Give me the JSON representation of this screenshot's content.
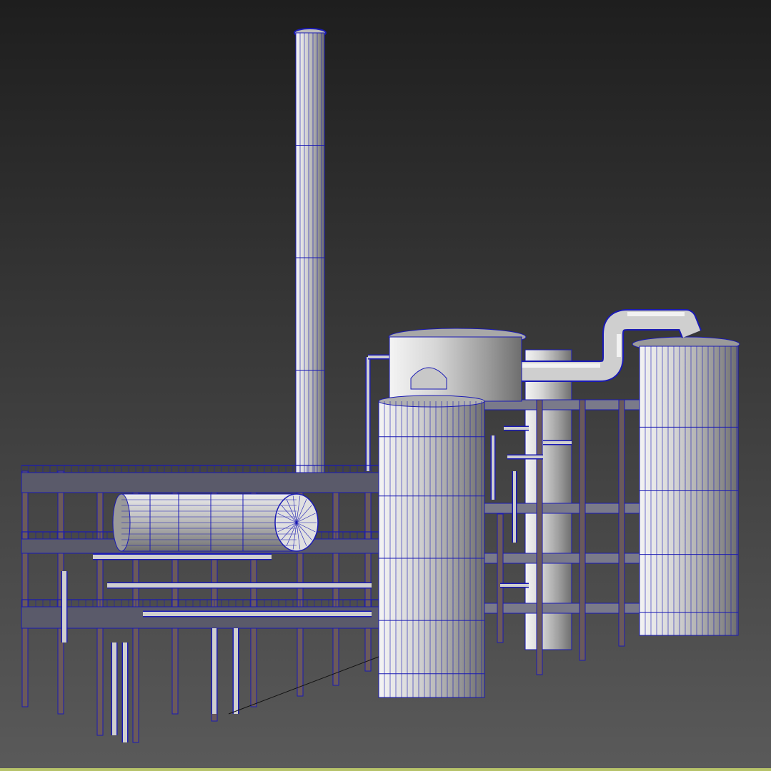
{
  "viewport": {
    "render_mode": "wireframe-on-shaded",
    "background_top": "#1e1e1e",
    "background_bottom": "#5a5a5a",
    "wire_color": "#1a1ab4",
    "surface_light": "#d8d8d8",
    "surface_dark": "#7a7a7a",
    "support_color": "#6b5a5a",
    "accent_strip": "#b7c36a"
  },
  "scene": {
    "subject": "refinery-unit",
    "objects": [
      "chimney-stack",
      "main-column",
      "right-column",
      "rear-column",
      "horizontal-drum",
      "overhead-pipe",
      "left-pipe-rack",
      "right-platform-structure"
    ]
  }
}
